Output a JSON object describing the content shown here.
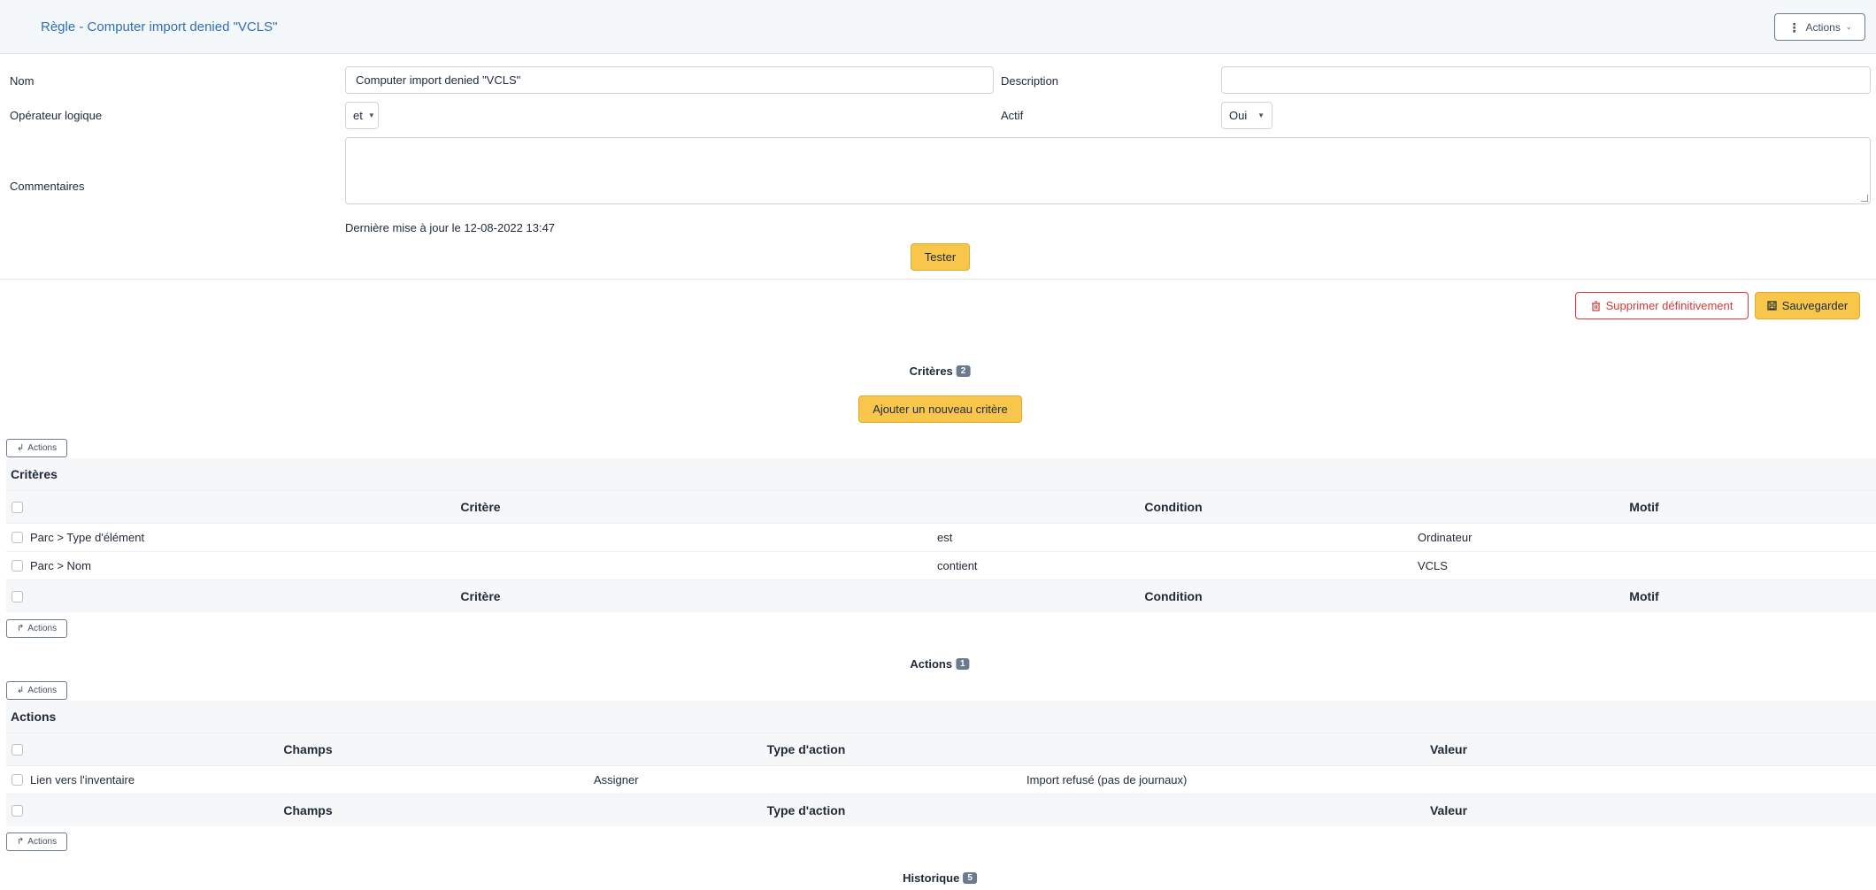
{
  "header": {
    "title": "Règle - Computer import denied \"VCLS\"",
    "actions_label": "Actions"
  },
  "form": {
    "name_label": "Nom",
    "name_value": "Computer import denied \"VCLS\"",
    "description_label": "Description",
    "description_value": "",
    "operator_label": "Opérateur logique",
    "operator_value": "et",
    "active_label": "Actif",
    "active_value": "Oui",
    "comments_label": "Commentaires",
    "last_update": "Dernière mise à jour le 12-08-2022 13:47",
    "test_button": "Tester",
    "delete_button": "Supprimer définitivement",
    "save_button": "Sauvegarder"
  },
  "criteria": {
    "title": "Critères",
    "count": "2",
    "add_button": "Ajouter un nouveau critère",
    "actions_button": "Actions",
    "caption": "Critères",
    "columns": [
      "Critère",
      "Condition",
      "Motif"
    ],
    "rows": [
      {
        "criterion": "Parc > Type d'élément",
        "condition": "est",
        "pattern": "Ordinateur"
      },
      {
        "criterion": "Parc > Nom",
        "condition": "contient",
        "pattern": "VCLS"
      }
    ]
  },
  "actions": {
    "title": "Actions",
    "count": "1",
    "actions_button": "Actions",
    "caption": "Actions",
    "columns": [
      "Champs",
      "Type d'action",
      "Valeur"
    ],
    "rows": [
      {
        "field": "Lien vers l'inventaire",
        "type": "Assigner",
        "value": "Import refusé (pas de journaux)"
      }
    ]
  },
  "history": {
    "title": "Historique",
    "count": "5"
  },
  "colors": {
    "accent_blue": "#2f6eb8",
    "primary_yellow": "#f8c64a",
    "danger_red": "#d63939",
    "badge_gray": "#6b7a8c"
  },
  "icons": {
    "actions_menu": "vertical-dots-icon",
    "delete": "trash-icon",
    "save": "floppy-disk-icon",
    "massive_top": "arrow-turn-down-icon",
    "massive_bottom": "arrow-turn-up-icon"
  }
}
